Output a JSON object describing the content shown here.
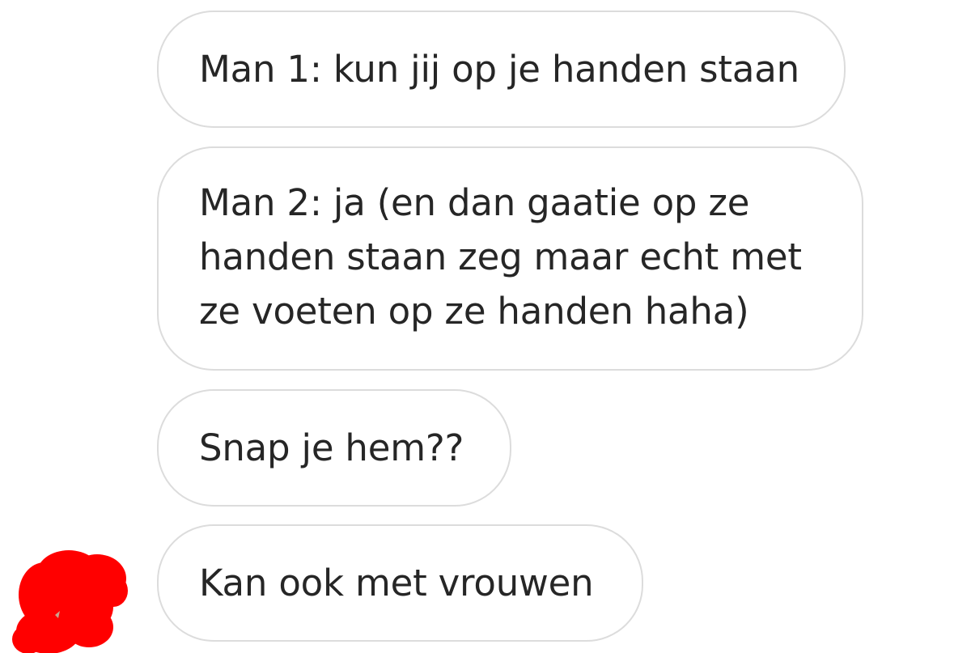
{
  "chat": {
    "messages": [
      {
        "lines": [
          "Man 1: kun jij op je handen staan"
        ]
      },
      {
        "lines": [
          "Man 2: ja (en dan gaatie op ze",
          "handen staan zeg maar echt met",
          "ze voeten op ze handen haha)"
        ]
      },
      {
        "lines": [
          "Snap je hem??"
        ]
      },
      {
        "lines": [
          "Kan ook met vrouwen"
        ]
      }
    ]
  },
  "colors": {
    "bubble_border": "#dcdcdc",
    "text": "#262626",
    "scribble": "#ff0000"
  },
  "icons": {
    "avatar": "redacted-avatar-scribble"
  }
}
